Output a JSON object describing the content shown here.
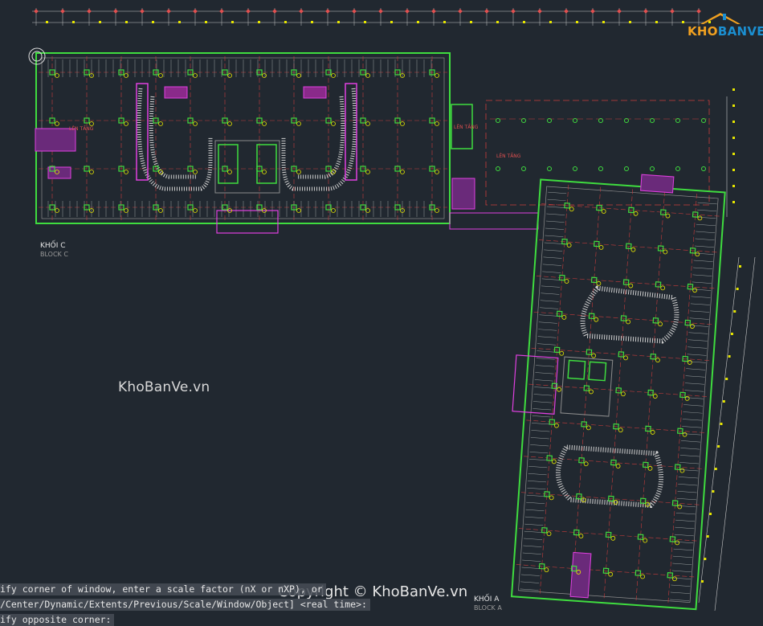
{
  "drawing": {
    "block_c_label": "KHỐI C",
    "block_c_sublabel": "BLOCK C",
    "block_a_label": "KHỐI A",
    "block_a_sublabel": "BLOCK A",
    "stair_label_1": "LÊN TẦNG",
    "stair_label_2": "LÊN TẦNG",
    "stair_label_3": "LÊN TẦNG"
  },
  "watermark": {
    "center": "KhoBanVe.vn",
    "copyright": "Copyright © KhoBanVe.vn",
    "logo_part1": "KHO",
    "logo_part2": "BANVE"
  },
  "command_line": {
    "line1": "ify corner of window, enter a scale factor (nX or nXP), or",
    "line2": "/Center/Dynamic/Extents/Previous/Scale/Window/Object] <real time>:",
    "line3": "ify opposite corner:"
  },
  "colors": {
    "background": "#212830",
    "wall": "#3fdc3f",
    "grid_axis": "#c83c3c",
    "fixture": "#e040e0",
    "dimension": "#e6e600",
    "gray": "#8c8c8c",
    "cyan": "#40c8c8"
  }
}
